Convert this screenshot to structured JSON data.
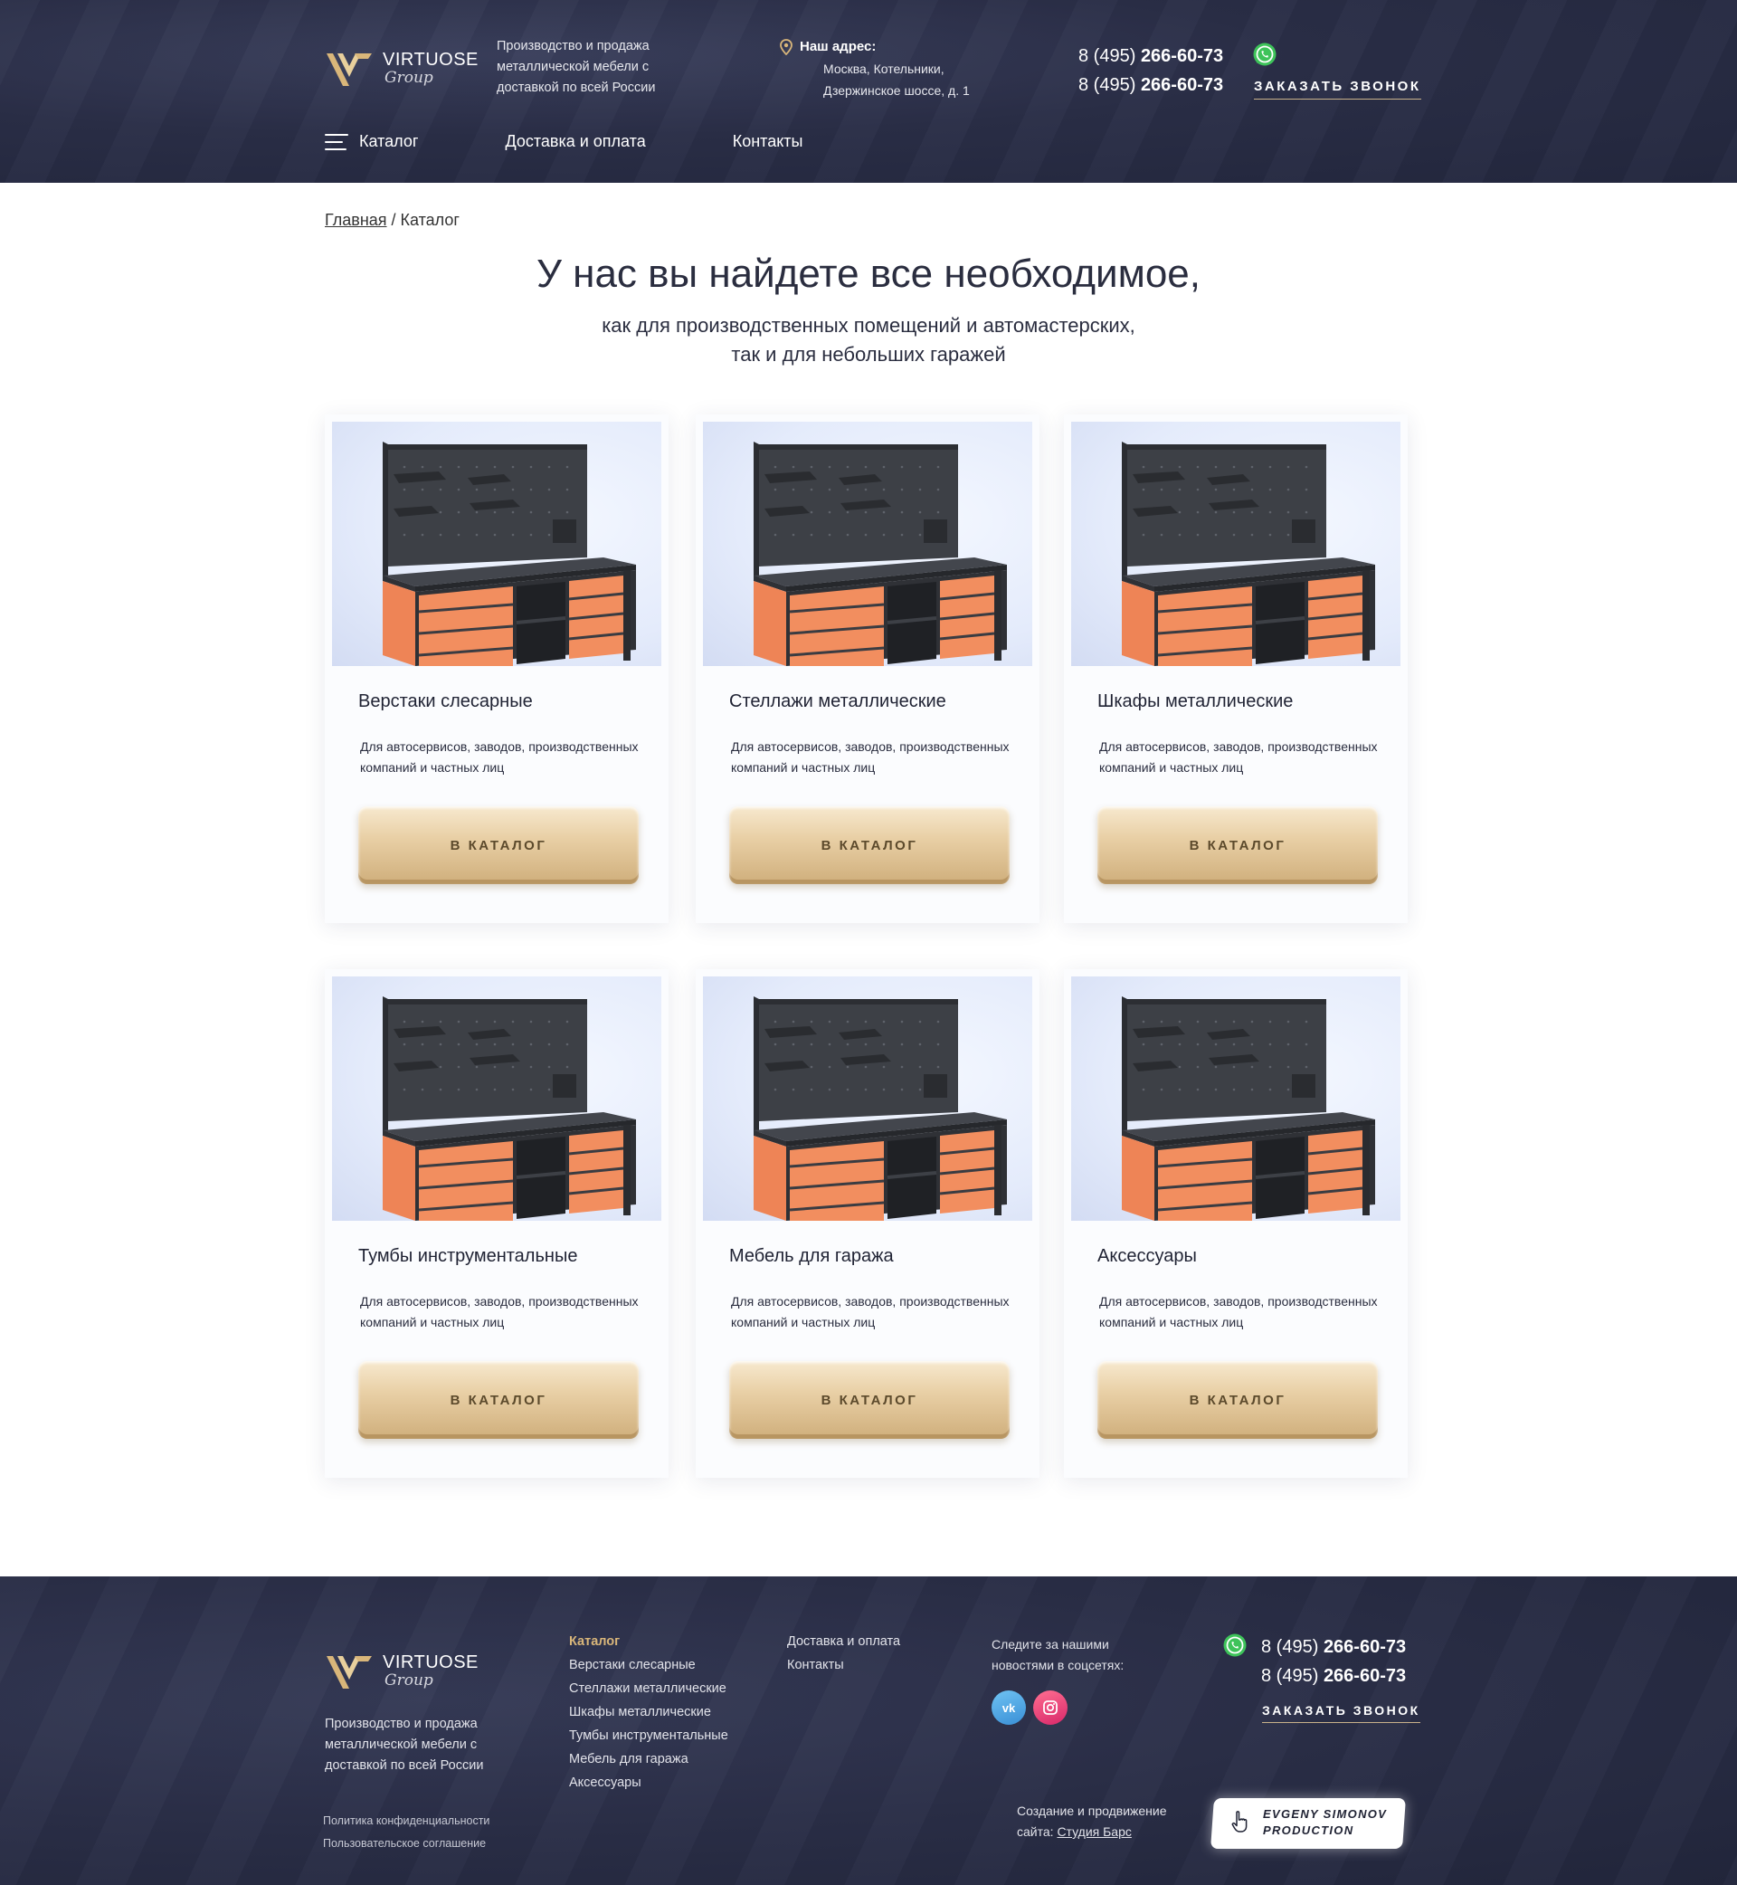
{
  "header": {
    "logo": {
      "name": "VIRTUOSE",
      "sub": "Group"
    },
    "tagline": "Производство и продажа металлической мебели с доставкой по всей России",
    "address": {
      "title": "Наш адрес:",
      "line1": "Москва, Котельники,",
      "line2": "Дзержинское шоссе, д. 1"
    },
    "phones": [
      {
        "prefix": "8 (495) ",
        "number": "266-60-73"
      },
      {
        "prefix": "8 (495) ",
        "number": "266-60-73"
      }
    ],
    "callback": "ЗАКАЗАТЬ ЗВОНОК",
    "nav": [
      "Каталог",
      "Доставка и оплата",
      "Контакты"
    ]
  },
  "breadcrumb": {
    "home": "Главная",
    "separator": " / ",
    "current": "Каталог"
  },
  "hero": {
    "title": "У нас вы найдете все необходимое,",
    "sub1": "как для производственных помещений и автомастерских,",
    "sub2": "так и для небольших гаражей"
  },
  "cards": [
    {
      "title": "Верстаки слесарные",
      "desc": "Для автосервисов, заводов, производственных компаний и частных лиц",
      "button": "В КАТАЛОГ"
    },
    {
      "title": "Стеллажи металлические",
      "desc": "Для автосервисов, заводов, производственных компаний и частных лиц",
      "button": "В КАТАЛОГ"
    },
    {
      "title": "Шкафы металлические",
      "desc": "Для автосервисов, заводов, производственных компаний и частных лиц",
      "button": "В КАТАЛОГ"
    },
    {
      "title": "Тумбы инструментальные",
      "desc": "Для автосервисов, заводов, производственных компаний и частных лиц",
      "button": "В КАТАЛОГ"
    },
    {
      "title": "Мебель для гаража",
      "desc": "Для автосервисов, заводов, производственных компаний и частных лиц",
      "button": "В КАТАЛОГ"
    },
    {
      "title": "Аксессуары",
      "desc": "Для автосервисов, заводов, производственных компаний и частных лиц",
      "button": "В КАТАЛОГ"
    }
  ],
  "footer": {
    "logo": {
      "name": "VIRTUOSE",
      "sub": "Group"
    },
    "tagline": "Производство и продажа металлической мебели с доставкой по всей России",
    "privacy": "Политика конфиденциальности",
    "agreement": "Пользовательское соглашение",
    "catalog": [
      "Каталог",
      "Верстаки слесарные",
      "Стеллажи металлические",
      "Шкафы металлические",
      "Тумбы инструментальные",
      "Мебель для гаража",
      "Аксессуары"
    ],
    "links": [
      "Доставка и оплата",
      "Контакты"
    ],
    "social_text": "Следите за нашими новостями в соцсетях:",
    "social": [
      {
        "name": "vk",
        "label": "vk"
      },
      {
        "name": "instagram",
        "label": ""
      }
    ],
    "phones": [
      {
        "prefix": "8 (495) ",
        "number": "266-60-73"
      },
      {
        "prefix": "8 (495) ",
        "number": "266-60-73"
      }
    ],
    "callback": "ЗАКАЗАТЬ ЗВОНОК",
    "credit_text1": "Создание и продвижение",
    "credit_text2": "сайта: ",
    "credit_link": "Студия Барс",
    "credit_box": "EVGENY SIMONOV PRODUCTION"
  },
  "colors": {
    "header_bg": "#2a2e47",
    "accent_gold": "#d9b67a",
    "drawer_orange": "#f08a5d",
    "button_gold": "#e9d0a6",
    "whatsapp": "#3ec35a"
  }
}
